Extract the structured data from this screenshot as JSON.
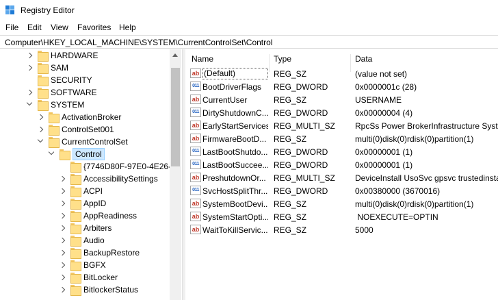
{
  "window": {
    "title": "Registry Editor"
  },
  "menu": [
    "File",
    "Edit",
    "View",
    "Favorites",
    "Help"
  ],
  "address": "Computer\\HKEY_LOCAL_MACHINE\\SYSTEM\\CurrentControlSet\\Control",
  "tree": [
    {
      "label": "HARDWARE",
      "expander": "collapsed",
      "level": 0
    },
    {
      "label": "SAM",
      "expander": "collapsed",
      "level": 0
    },
    {
      "label": "SECURITY",
      "expander": "none",
      "level": 0
    },
    {
      "label": "SOFTWARE",
      "expander": "collapsed",
      "level": 0
    },
    {
      "label": "SYSTEM",
      "expander": "expanded",
      "level": 0
    },
    {
      "label": "ActivationBroker",
      "expander": "collapsed",
      "level": 1
    },
    {
      "label": "ControlSet001",
      "expander": "collapsed",
      "level": 1
    },
    {
      "label": "CurrentControlSet",
      "expander": "expanded",
      "level": 1
    },
    {
      "label": "Control",
      "expander": "expanded",
      "level": 2,
      "selected": true
    },
    {
      "label": "{7746D80F-97E0-4E26-9",
      "expander": "none",
      "level": 3
    },
    {
      "label": "AccessibilitySettings",
      "expander": "collapsed",
      "level": 3
    },
    {
      "label": "ACPI",
      "expander": "collapsed",
      "level": 3
    },
    {
      "label": "AppID",
      "expander": "collapsed",
      "level": 3
    },
    {
      "label": "AppReadiness",
      "expander": "collapsed",
      "level": 3
    },
    {
      "label": "Arbiters",
      "expander": "collapsed",
      "level": 3
    },
    {
      "label": "Audio",
      "expander": "collapsed",
      "level": 3
    },
    {
      "label": "BackupRestore",
      "expander": "collapsed",
      "level": 3
    },
    {
      "label": "BGFX",
      "expander": "collapsed",
      "level": 3
    },
    {
      "label": "BitLocker",
      "expander": "collapsed",
      "level": 3
    },
    {
      "label": "BitlockerStatus",
      "expander": "collapsed",
      "level": 3
    }
  ],
  "columns": {
    "name": "Name",
    "type": "Type",
    "data": "Data"
  },
  "values": [
    {
      "name": "(Default)",
      "type": "REG_SZ",
      "data": "(value not set)",
      "icon": "string-value-icon",
      "selected": true
    },
    {
      "name": "BootDriverFlags",
      "type": "REG_DWORD",
      "data": "0x0000001c (28)",
      "icon": "binary-value-icon"
    },
    {
      "name": "CurrentUser",
      "type": "REG_SZ",
      "data": "USERNAME",
      "icon": "string-value-icon"
    },
    {
      "name": "DirtyShutdownC...",
      "type": "REG_DWORD",
      "data": "0x00000004 (4)",
      "icon": "binary-value-icon"
    },
    {
      "name": "EarlyStartServices",
      "type": "REG_MULTI_SZ",
      "data": "RpcSs Power BrokerInfrastructure Syster",
      "icon": "string-value-icon"
    },
    {
      "name": "FirmwareBootD...",
      "type": "REG_SZ",
      "data": "multi(0)disk(0)rdisk(0)partition(1)",
      "icon": "string-value-icon"
    },
    {
      "name": "LastBootShutdo...",
      "type": "REG_DWORD",
      "data": "0x00000001 (1)",
      "icon": "binary-value-icon"
    },
    {
      "name": "LastBootSuccee...",
      "type": "REG_DWORD",
      "data": "0x00000001 (1)",
      "icon": "binary-value-icon"
    },
    {
      "name": "PreshutdownOr...",
      "type": "REG_MULTI_SZ",
      "data": "DeviceInstall UsoSvc gpsvc trustedinstal",
      "icon": "string-value-icon"
    },
    {
      "name": "SvcHostSplitThr...",
      "type": "REG_DWORD",
      "data": "0x00380000 (3670016)",
      "icon": "binary-value-icon"
    },
    {
      "name": "SystemBootDevi...",
      "type": "REG_SZ",
      "data": "multi(0)disk(0)rdisk(0)partition(1)",
      "icon": "string-value-icon"
    },
    {
      "name": "SystemStartOpti...",
      "type": "REG_SZ",
      "data": " NOEXECUTE=OPTIN",
      "icon": "string-value-icon"
    },
    {
      "name": "WaitToKillServic...",
      "type": "REG_SZ",
      "data": "5000",
      "icon": "string-value-icon"
    }
  ]
}
